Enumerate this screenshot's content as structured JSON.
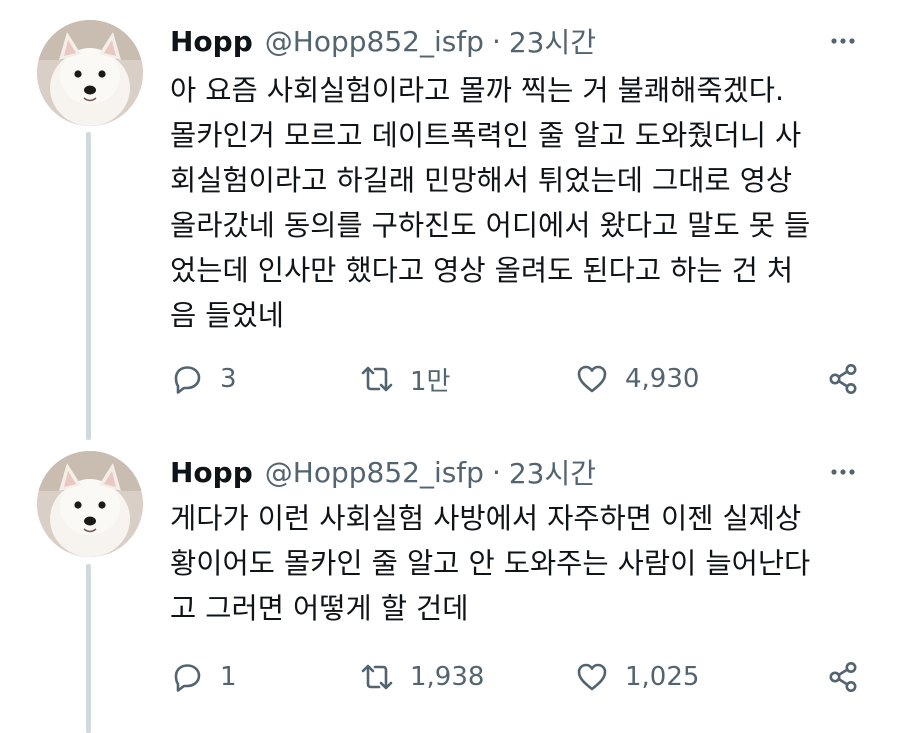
{
  "tweets": [
    {
      "name": "Hopp",
      "handle": "@Hopp852_isfp",
      "separator": "·",
      "time": "23시간",
      "text": "아 요즘 사회실험이라고 몰까 찍는 거 불쾌해죽겠다.\n몰카인거 모르고 데이트폭력인 줄 알고 도와줬더니 사\n회실험이라고 하길래 민망해서 튀었는데 그대로 영상\n올라갔네 동의를 구하진도 어디에서 왔다고 말도 못 들\n었는데 인사만 했다고 영상 올려도 된다고 하는 건 처\n음 들었네",
      "replies": "3",
      "retweets": "1만",
      "likes": "4,930"
    },
    {
      "name": "Hopp",
      "handle": "@Hopp852_isfp",
      "separator": "·",
      "time": "23시간",
      "text": "게다가 이런 사회실험 사방에서 자주하면 이젠 실제상\n황이어도 몰카인 줄 알고 안 도와주는 사람이 늘어난다\n고 그러면 어떻게 할 건데",
      "replies": "1",
      "retweets": "1,938",
      "likes": "1,025"
    }
  ],
  "icons": {
    "more": "more-horizontal-icon",
    "reply": "reply-icon",
    "retweet": "retweet-icon",
    "like": "heart-icon",
    "share": "share-icon"
  },
  "colors": {
    "text": "#0f1419",
    "secondary": "#536471",
    "thread_line": "#cfd9de"
  }
}
